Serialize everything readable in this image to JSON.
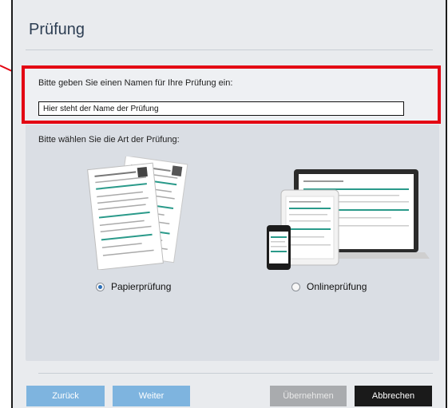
{
  "dialog": {
    "title": "Prüfung"
  },
  "name_section": {
    "label": "Bitte geben Sie einen Namen für Ihre Prüfung ein:",
    "input_value": "Hier steht der Name der Prüfung"
  },
  "type_section": {
    "label": "Bitte wählen Sie die Art der Prüfung:",
    "options": [
      {
        "label": "Papierprüfung",
        "checked": true
      },
      {
        "label": "Onlineprüfung",
        "checked": false
      }
    ]
  },
  "buttons": {
    "back": "Zurück",
    "next": "Weiter",
    "apply": "Übernehmen",
    "cancel": "Abbrechen"
  },
  "colors": {
    "accent_blue": "#7eb4df",
    "highlight_red": "#e30613",
    "title_color": "#2d3e53"
  }
}
